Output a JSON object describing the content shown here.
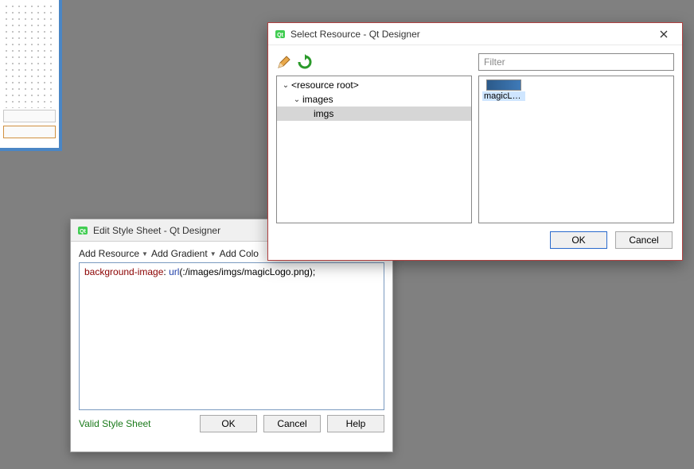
{
  "editStyleSheet": {
    "title": "Edit Style Sheet - Qt Designer",
    "toolbar": {
      "addResource": "Add Resource",
      "addGradient": "Add Gradient",
      "addColor": "Add Colo"
    },
    "editor": {
      "property": "background-image",
      "sep": ": ",
      "urlKw": "url",
      "value": "(:/images/imgs/magicLogo.png);"
    },
    "status": "Valid Style Sheet",
    "buttons": {
      "ok": "OK",
      "cancel": "Cancel",
      "help": "Help"
    }
  },
  "selectResource": {
    "title": "Select Resource - Qt Designer",
    "filterPlaceholder": "Filter",
    "tree": {
      "root": "<resource root>",
      "child1": "images",
      "child2": "imgs"
    },
    "thumb": {
      "caption": "magicLo..."
    },
    "buttons": {
      "ok": "OK",
      "cancel": "Cancel"
    }
  },
  "icons": {
    "qt": "qt-icon",
    "pencil": "pencil-icon",
    "reload": "reload-icon",
    "close": "close-icon",
    "chevronDown": "chevron-down-icon"
  }
}
